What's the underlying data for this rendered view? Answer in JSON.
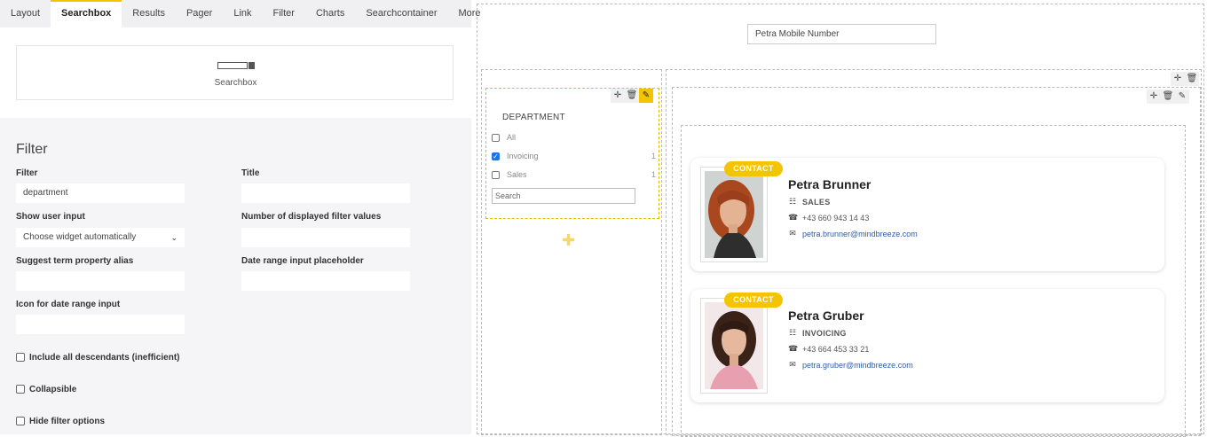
{
  "tabs": [
    "Layout",
    "Searchbox",
    "Results",
    "Pager",
    "Link",
    "Filter",
    "Charts",
    "Searchcontainer",
    "More"
  ],
  "active_tab": "Searchbox",
  "widget_preview": {
    "label": "Searchbox"
  },
  "filter_panel": {
    "title": "Filter",
    "filter_label": "Filter",
    "filter_value": "department",
    "title_label": "Title",
    "title_value": "",
    "show_user_input_label": "Show user input",
    "show_user_input_value": "Choose widget automatically",
    "num_values_label": "Number of displayed filter values",
    "num_values_value": "",
    "suggest_alias_label": "Suggest term property alias",
    "suggest_alias_value": "",
    "date_placeholder_label": "Date range input placeholder",
    "date_placeholder_value": "",
    "date_icon_label": "Icon for date range input",
    "date_icon_value": "",
    "include_descendants_label": "Include all descendants (inefficient)",
    "collapsible_label": "Collapsible",
    "hide_options_label": "Hide filter options"
  },
  "preview": {
    "search_value": "Petra Mobile Number",
    "filter_widget": {
      "title": "DEPARTMENT",
      "options": [
        {
          "label": "All",
          "count": "",
          "checked": false
        },
        {
          "label": "Invoicing",
          "count": "1",
          "checked": true
        },
        {
          "label": "Sales",
          "count": "1",
          "checked": false
        }
      ],
      "search_placeholder": "Search"
    },
    "results": [
      {
        "badge": "CONTACT",
        "name": "Petra Brunner",
        "department": "SALES",
        "phone": "+43 660 943 14 43",
        "email": "petra.brunner@mindbreeze.com"
      },
      {
        "badge": "CONTACT",
        "name": "Petra Gruber",
        "department": "INVOICING",
        "phone": "+43 664 453 33 21",
        "email": "petra.gruber@mindbreeze.com"
      }
    ]
  },
  "icons": {
    "move": "move-icon",
    "delete": "trash-icon",
    "edit": "pencil-icon",
    "add": "plus-icon",
    "department": "org-chart-icon",
    "phone": "phone-icon",
    "email": "envelope-icon"
  },
  "colors": {
    "accent": "#f5c400",
    "link": "#2d5fa3",
    "checkbox": "#1a73e8"
  }
}
